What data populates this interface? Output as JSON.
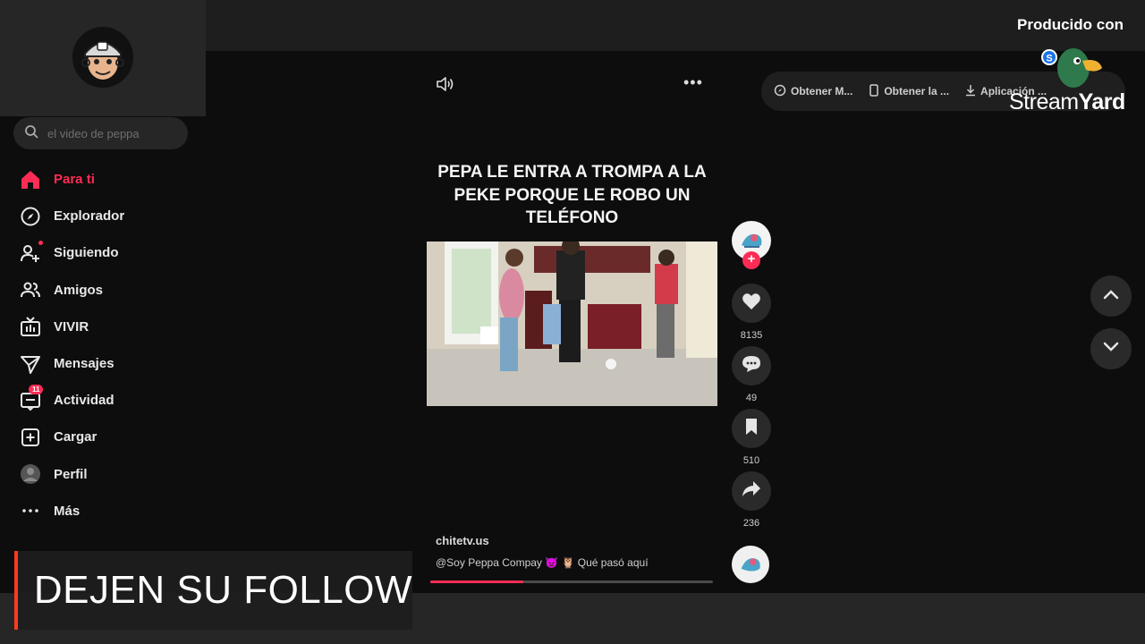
{
  "overlay": {
    "producido_label": "Producido con",
    "brand_stream": "Stream",
    "brand_yard": "Yard",
    "brand_badge": "S",
    "follow_banner": "DEJEN SU FOLLOW",
    "accent_bar_color": "#ff3b1f"
  },
  "search": {
    "value": "",
    "placeholder": "el video de peppa"
  },
  "sidebar": {
    "items": [
      {
        "label": "Para ti",
        "icon": "home-icon",
        "active": true
      },
      {
        "label": "Explorador",
        "icon": "compass-icon"
      },
      {
        "label": "Siguiendo",
        "icon": "user-follow-icon"
      },
      {
        "label": "Amigos",
        "icon": "friends-icon"
      },
      {
        "label": "VIVIR",
        "icon": "live-tv-icon"
      },
      {
        "label": "Mensajes",
        "icon": "send-icon"
      },
      {
        "label": "Actividad",
        "icon": "activity-icon",
        "badge": "11"
      },
      {
        "label": "Cargar",
        "icon": "upload-icon"
      },
      {
        "label": "Perfil",
        "icon": "profile-avatar-icon"
      },
      {
        "label": "Más",
        "icon": "more-dots-icon"
      }
    ]
  },
  "get_bar": {
    "option_1": "Obtener M...",
    "option_2": "Obtener la ...",
    "option_3": "Aplicación ..."
  },
  "video": {
    "title": "PEPA LE ENTRA A TROMPA A LA PEKE PORQUE LE ROBO UN TELÉFONO",
    "author": "chitetv.us",
    "caption": "@Soy Peppa Compay 👿 🦉 Qué pasó aquí",
    "progress": 0.33
  },
  "actions": {
    "likes": "8135",
    "comments": "49",
    "saves": "510",
    "shares": "236"
  },
  "colors": {
    "accent": "#fe2c55",
    "background": "#0d0d0d"
  }
}
